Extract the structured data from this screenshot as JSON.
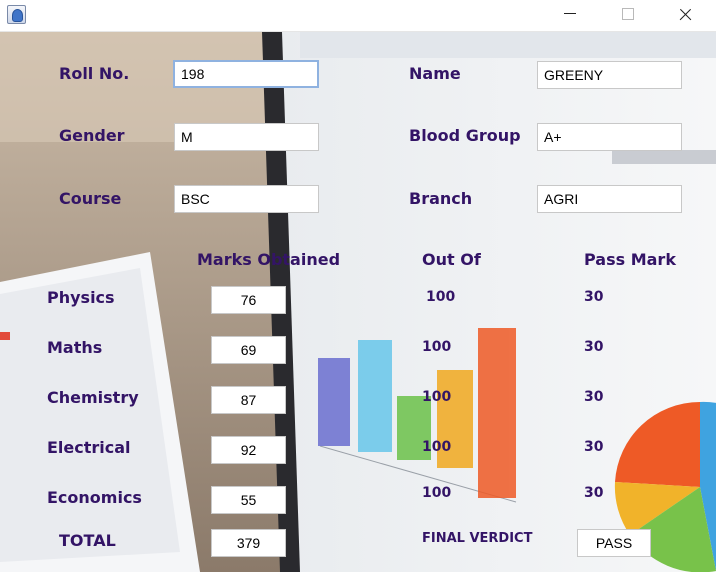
{
  "form": {
    "roll_no": {
      "label": "Roll No.",
      "value": "198"
    },
    "name": {
      "label": "Name",
      "value": "GREENY"
    },
    "gender": {
      "label": "Gender",
      "value": "M"
    },
    "blood_group": {
      "label": "Blood Group",
      "value": "A+"
    },
    "course": {
      "label": "Course",
      "value": "BSC"
    },
    "branch": {
      "label": "Branch",
      "value": "AGRI"
    }
  },
  "marks": {
    "headers": {
      "obtained": "Marks Obtained",
      "out_of": "Out Of",
      "pass_mark": "Pass Mark"
    },
    "rows": [
      {
        "subject": "Physics",
        "obtained": "76",
        "out_of": "100",
        "pass_mark": "30"
      },
      {
        "subject": "Maths",
        "obtained": "69",
        "out_of": "100",
        "pass_mark": "30"
      },
      {
        "subject": "Chemistry",
        "obtained": "87",
        "out_of": "100",
        "pass_mark": "30"
      },
      {
        "subject": "Electrical",
        "obtained": "92",
        "out_of": "100",
        "pass_mark": "30"
      },
      {
        "subject": "Economics",
        "obtained": "55",
        "out_of": "100",
        "pass_mark": "30"
      }
    ],
    "total": {
      "label": "TOTAL",
      "value": "379"
    },
    "verdict": {
      "label": "FINAL VERDICT",
      "value": "PASS"
    }
  },
  "colors": {
    "label_text": "#331466",
    "field_background": "#ffffff",
    "field_border": "#c8c8c8",
    "focus_border": "#8fb2e0"
  }
}
